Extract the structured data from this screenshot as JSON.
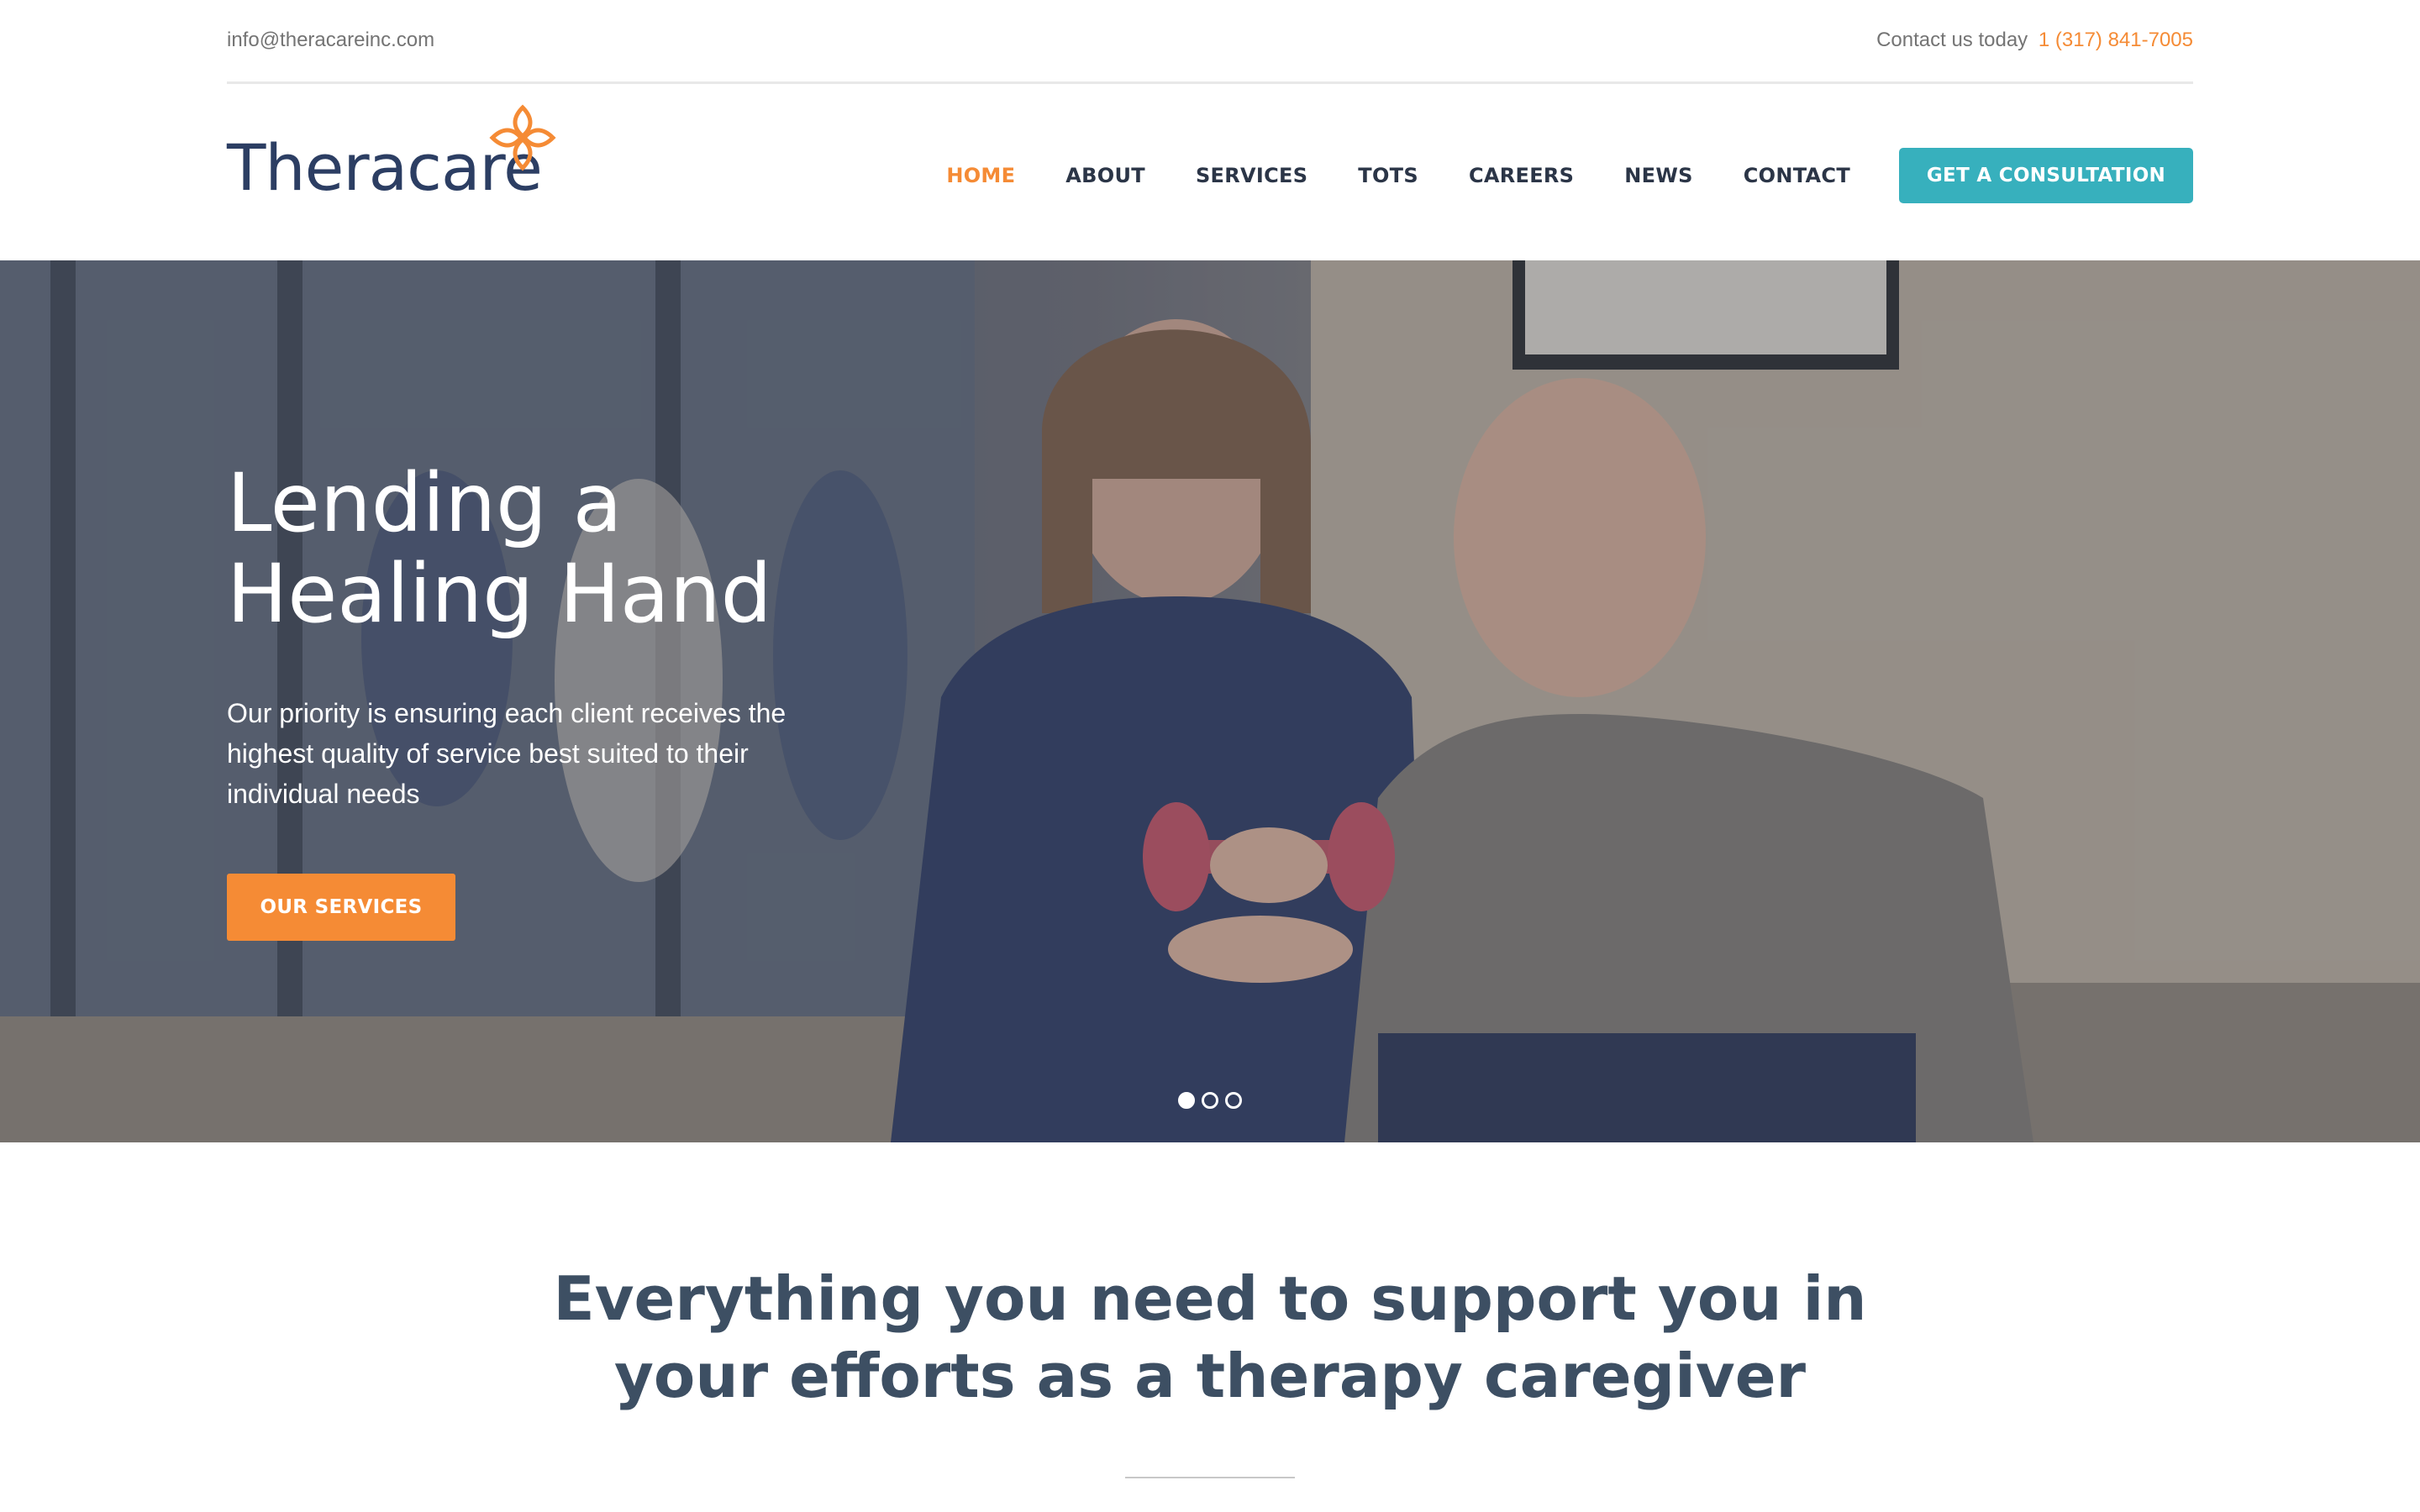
{
  "topbar": {
    "email": "info@theracareinc.com",
    "contact_label": "Contact us today",
    "phone": "1 (317) 841-7005"
  },
  "logo": {
    "text": "Theracare",
    "mark_icon": "orange-four-petal-cross-icon"
  },
  "nav": {
    "items": [
      {
        "label": "HOME",
        "active": true
      },
      {
        "label": "ABOUT"
      },
      {
        "label": "SERVICES"
      },
      {
        "label": "TOTS"
      },
      {
        "label": "CAREERS"
      },
      {
        "label": "NEWS"
      },
      {
        "label": "CONTACT"
      }
    ],
    "cta_label": "GET A CONSULTATION"
  },
  "hero": {
    "title_line1": "Lending a",
    "title_line2": "Healing Hand",
    "text": "Our priority is ensuring each client receives the highest quality of service best suited to their individual needs",
    "button_label": "OUR SERVICES",
    "slides": 3,
    "active_slide": 1
  },
  "section": {
    "title_line1": "Everything you need to support you in",
    "title_line2": "your efforts as a therapy caregiver"
  },
  "colors": {
    "accent_orange": "#f58b35",
    "teal": "#37b0bd",
    "navy": "#2c3e63",
    "text_dark": "#2b3547",
    "muted": "#747474"
  }
}
